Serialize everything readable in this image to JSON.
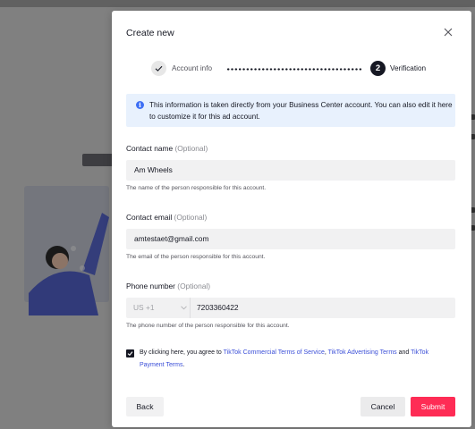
{
  "modal": {
    "title": "Create new",
    "close_icon": "close-icon"
  },
  "stepper": {
    "steps": [
      {
        "label": "Account info",
        "state": "completed",
        "icon": "check-icon"
      },
      {
        "label": "Verification",
        "state": "active",
        "number": "2"
      }
    ]
  },
  "info_banner": {
    "icon": "info-icon",
    "text": "This information is taken directly from your Business Center account. You can also edit it here to customize it for this ad account."
  },
  "form": {
    "contact_name": {
      "label": "Contact name",
      "optional": "(Optional)",
      "value": "Am Wheels",
      "help": "The name of the person responsible for this account."
    },
    "contact_email": {
      "label": "Contact email",
      "optional": "(Optional)",
      "value": "amtestaet@gmail.com",
      "help": "The email of the person responsible for this account."
    },
    "phone_number": {
      "label": "Phone number",
      "optional": "(Optional)",
      "country_code": "US +1",
      "value": "7203360422",
      "help": "The phone number of the person responsible for this account."
    }
  },
  "terms": {
    "checked": true,
    "prefix": "By clicking here, you agree to ",
    "link1": "TikTok Commercial Terms of Service",
    "sep1": ", ",
    "link2": "TikTok Advertising Terms",
    "sep2": " and ",
    "link3": "TikTok Payment Terms",
    "suffix": "."
  },
  "footer": {
    "back_label": "Back",
    "cancel_label": "Cancel",
    "submit_label": "Submit"
  },
  "colors": {
    "primary": "#fe2c55",
    "link": "#3b4fd8",
    "info_bg": "#e8f1fd"
  }
}
